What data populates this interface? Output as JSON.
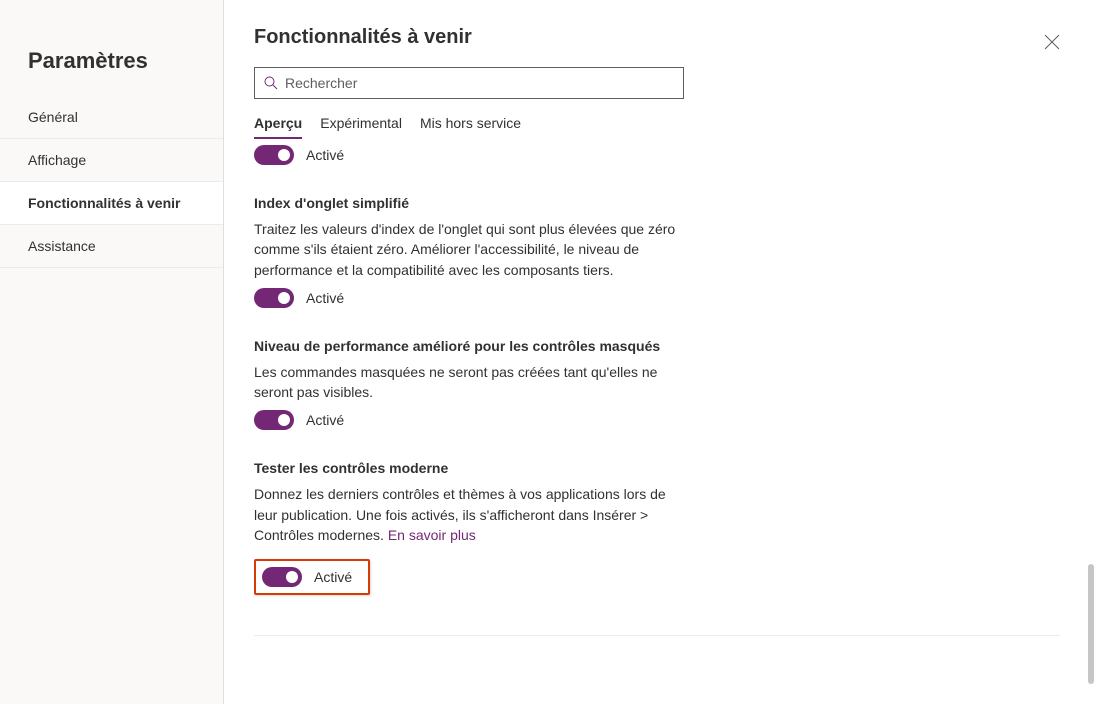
{
  "sidebar": {
    "title": "Paramètres",
    "items": [
      {
        "label": "Général"
      },
      {
        "label": "Affichage"
      },
      {
        "label": "Fonctionnalités à venir"
      },
      {
        "label": "Assistance"
      }
    ]
  },
  "header": {
    "title": "Fonctionnalités à venir",
    "search_placeholder": "Rechercher"
  },
  "tabs": [
    {
      "label": "Aperçu"
    },
    {
      "label": "Expérimental"
    },
    {
      "label": "Mis hors service"
    }
  ],
  "toggle_on_label": "Activé",
  "settings": [
    {
      "title": "Index d'onglet simplifié",
      "desc": "Traitez les valeurs d'index de l'onglet qui sont plus élevées que zéro comme s'ils étaient zéro. Améliorer l'accessibilité, le niveau de performance et la compatibilité avec les composants tiers.",
      "state": "Activé"
    },
    {
      "title": "Niveau de performance amélioré pour les contrôles masqués",
      "desc": "Les commandes masquées ne seront pas créées tant qu'elles ne seront pas visibles.",
      "state": "Activé"
    },
    {
      "title": "Tester les contrôles moderne",
      "desc": "Donnez les derniers contrôles et thèmes à vos applications lors de leur publication. Une fois activés, ils s'afficheront dans Insérer > Contrôles modernes. ",
      "link": "En savoir plus",
      "state": "Activé"
    }
  ]
}
